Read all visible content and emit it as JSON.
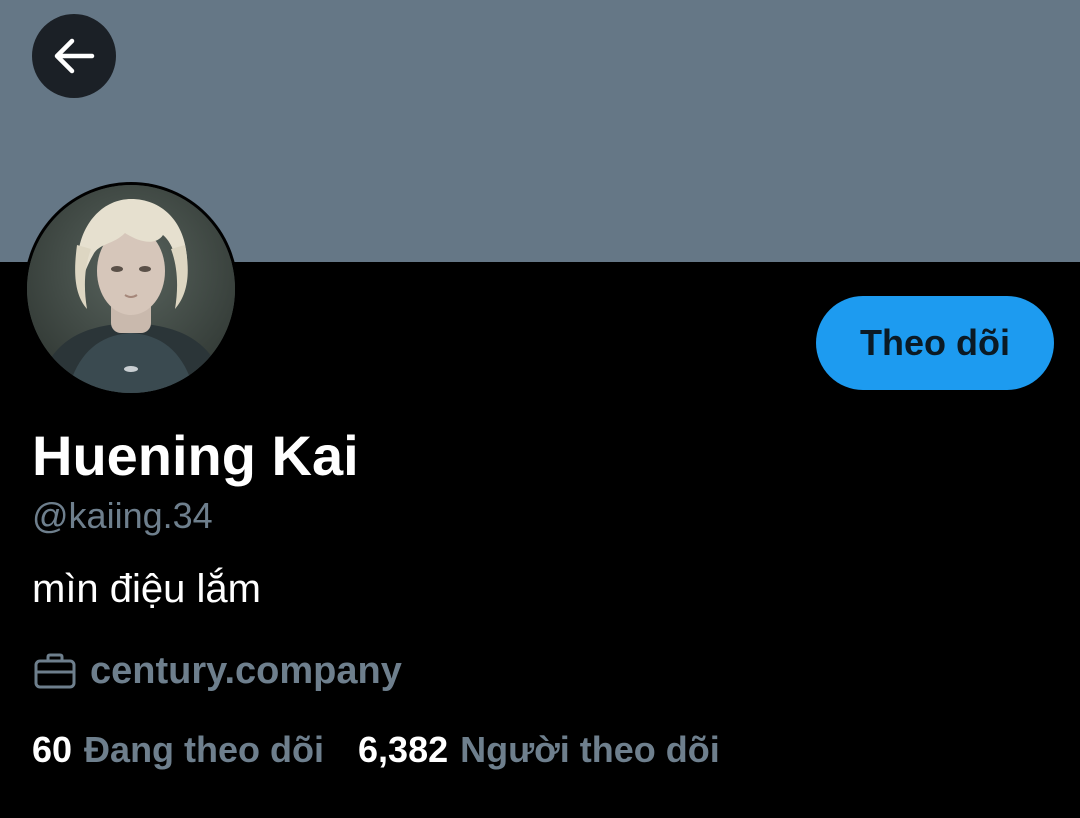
{
  "profile": {
    "name": "Huening Kai",
    "handle": "@kaiing.34",
    "bio": "mìn điệu lắm",
    "website": "century.company"
  },
  "actions": {
    "follow_label": "Theo dõi"
  },
  "stats": {
    "following_count": "60",
    "following_label": "Đang theo dõi",
    "followers_count": "6,382",
    "followers_label": "Người theo dõi"
  },
  "icons": {
    "back": "back-arrow-icon",
    "website": "briefcase-icon"
  },
  "colors": {
    "banner": "#657786",
    "background": "#000000",
    "accent": "#1d9bf0",
    "secondary_text": "#6e7f8d",
    "primary_text": "#ffffff"
  }
}
